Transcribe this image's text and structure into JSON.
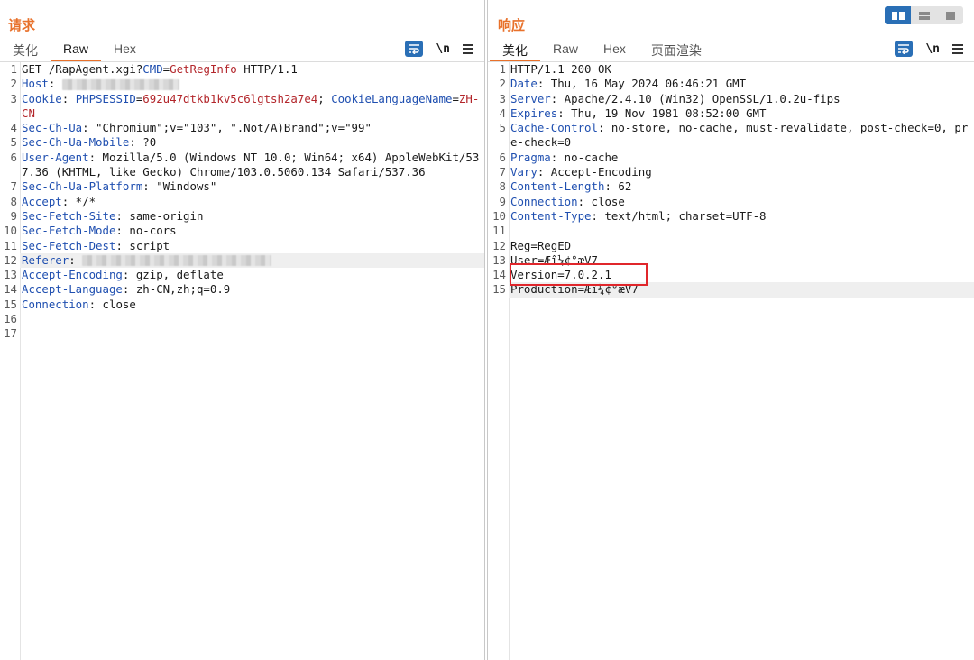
{
  "request": {
    "title": "请求",
    "tabs": [
      "美化",
      "Raw",
      "Hex"
    ],
    "active_tab": "Raw",
    "newline_label": "\\n",
    "lines": [
      {
        "n": "1",
        "parts": [
          [
            "t",
            "GET /RapAgent.xgi?"
          ],
          [
            "k",
            "CMD"
          ],
          [
            "t",
            "="
          ],
          [
            "v",
            "GetRegInfo"
          ],
          [
            "t",
            " HTTP/1.1"
          ]
        ]
      },
      {
        "n": "2",
        "parts": [
          [
            "k",
            "Host"
          ],
          [
            "t",
            ": "
          ],
          [
            "b",
            "130"
          ]
        ]
      },
      {
        "n": "3",
        "parts": [
          [
            "k",
            "Cookie"
          ],
          [
            "t",
            ": "
          ],
          [
            "k",
            "PHPSESSID"
          ],
          [
            "t",
            "="
          ],
          [
            "v",
            "692u47dtkb1kv5c6lgtsh2a7e4"
          ],
          [
            "t",
            "; "
          ],
          [
            "k",
            "CookieLanguageName"
          ],
          [
            "t",
            "="
          ],
          [
            "v",
            "ZH-CN"
          ]
        ]
      },
      {
        "n": "4",
        "parts": [
          [
            "k",
            "Sec-Ch-Ua"
          ],
          [
            "t",
            ": \"Chromium\";v=\"103\", \".Not/A)Brand\";v=\"99\""
          ]
        ]
      },
      {
        "n": "5",
        "parts": [
          [
            "k",
            "Sec-Ch-Ua-Mobile"
          ],
          [
            "t",
            ": ?0"
          ]
        ]
      },
      {
        "n": "6",
        "parts": [
          [
            "k",
            "User-Agent"
          ],
          [
            "t",
            ": Mozilla/5.0 (Windows NT 10.0; Win64; x64) AppleWebKit/537.36 (KHTML, like Gecko) Chrome/103.0.5060.134 Safari/537.36"
          ]
        ]
      },
      {
        "n": "7",
        "parts": [
          [
            "k",
            "Sec-Ch-Ua-Platform"
          ],
          [
            "t",
            ": \"Windows\""
          ]
        ]
      },
      {
        "n": "8",
        "parts": [
          [
            "k",
            "Accept"
          ],
          [
            "t",
            ": */*"
          ]
        ]
      },
      {
        "n": "9",
        "parts": [
          [
            "k",
            "Sec-Fetch-Site"
          ],
          [
            "t",
            ": same-origin"
          ]
        ]
      },
      {
        "n": "10",
        "parts": [
          [
            "k",
            "Sec-Fetch-Mode"
          ],
          [
            "t",
            ": no-cors"
          ]
        ]
      },
      {
        "n": "11",
        "parts": [
          [
            "k",
            "Sec-Fetch-Dest"
          ],
          [
            "t",
            ": script"
          ]
        ]
      },
      {
        "n": "12",
        "hl": true,
        "parts": [
          [
            "k",
            "Referer"
          ],
          [
            "t",
            ": "
          ],
          [
            "b",
            "210"
          ]
        ]
      },
      {
        "n": "13",
        "parts": [
          [
            "k",
            "Accept-Encoding"
          ],
          [
            "t",
            ": gzip, deflate"
          ]
        ]
      },
      {
        "n": "14",
        "parts": [
          [
            "k",
            "Accept-Language"
          ],
          [
            "t",
            ": zh-CN,zh;q=0.9"
          ]
        ]
      },
      {
        "n": "15",
        "parts": [
          [
            "k",
            "Connection"
          ],
          [
            "t",
            ": close"
          ]
        ]
      },
      {
        "n": "16",
        "parts": []
      },
      {
        "n": "17",
        "parts": []
      }
    ]
  },
  "response": {
    "title": "响应",
    "tabs": [
      "美化",
      "Raw",
      "Hex",
      "页面渲染"
    ],
    "active_tab": "美化",
    "newline_label": "\\n",
    "lines": [
      {
        "n": "1",
        "parts": [
          [
            "t",
            "HTTP/1.1 200 OK"
          ]
        ]
      },
      {
        "n": "2",
        "parts": [
          [
            "k",
            "Date"
          ],
          [
            "t",
            ": Thu, 16 May 2024 06:46:21 GMT"
          ]
        ]
      },
      {
        "n": "3",
        "parts": [
          [
            "k",
            "Server"
          ],
          [
            "t",
            ": Apache/2.4.10 (Win32) OpenSSL/1.0.2u-fips"
          ]
        ]
      },
      {
        "n": "4",
        "parts": [
          [
            "k",
            "Expires"
          ],
          [
            "t",
            ": Thu, 19 Nov 1981 08:52:00 GMT"
          ]
        ]
      },
      {
        "n": "5",
        "parts": [
          [
            "k",
            "Cache-Control"
          ],
          [
            "t",
            ": no-store, no-cache, must-revalidate, post-check=0, pre-check=0"
          ]
        ]
      },
      {
        "n": "6",
        "parts": [
          [
            "k",
            "Pragma"
          ],
          [
            "t",
            ": no-cache"
          ]
        ]
      },
      {
        "n": "7",
        "parts": [
          [
            "k",
            "Vary"
          ],
          [
            "t",
            ": Accept-Encoding"
          ]
        ]
      },
      {
        "n": "8",
        "parts": [
          [
            "k",
            "Content-Length"
          ],
          [
            "t",
            ": 62"
          ]
        ]
      },
      {
        "n": "9",
        "parts": [
          [
            "k",
            "Connection"
          ],
          [
            "t",
            ": close"
          ]
        ]
      },
      {
        "n": "10",
        "parts": [
          [
            "k",
            "Content-Type"
          ],
          [
            "t",
            ": text/html; charset=UTF-8"
          ]
        ]
      },
      {
        "n": "11",
        "parts": []
      },
      {
        "n": "12",
        "parts": [
          [
            "t",
            "Reg=RegED"
          ]
        ]
      },
      {
        "n": "13",
        "parts": [
          [
            "t",
            "User=Æî¼¢°æV7"
          ]
        ]
      },
      {
        "n": "14",
        "parts": [
          [
            "t",
            "Version=7.0.2.1"
          ]
        ]
      },
      {
        "n": "15",
        "hl": true,
        "parts": [
          [
            "t",
            "Production=Æî¼¢°æV7"
          ]
        ]
      }
    ]
  },
  "colors": {
    "accent": "#e8712b",
    "key": "#1f4fb0",
    "value": "#b3262b",
    "highlight_box": "#e0262b",
    "toolbar_blue": "#2a6fb6"
  }
}
